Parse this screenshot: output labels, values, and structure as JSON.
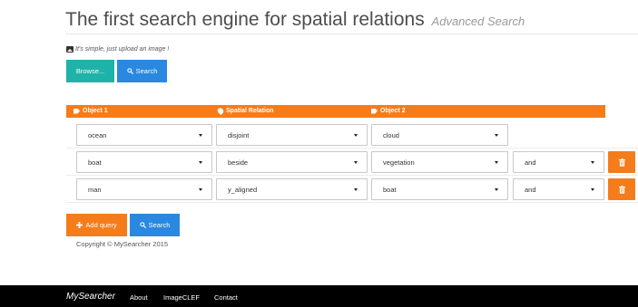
{
  "header": {
    "title": "The first search engine for spatial relations",
    "subtitle": "Advanced Search"
  },
  "upload": {
    "hint": "It's simple, just upload an image !",
    "browse_label": "Browse...",
    "search_label": "Search"
  },
  "table": {
    "columns": [
      "Object 1",
      "Spatial Relation",
      "Object 2"
    ],
    "rows": [
      {
        "object1": "ocean",
        "relation": "disjoint",
        "object2": "cloud",
        "connector": ""
      },
      {
        "object1": "boat",
        "relation": "beside",
        "object2": "vegetation",
        "connector": "and"
      },
      {
        "object1": "man",
        "relation": "y_aligned",
        "object2": "boat",
        "connector": "and"
      }
    ]
  },
  "actions": {
    "add_query_label": "Add query",
    "search_label": "Search"
  },
  "copyright": "Copyright © MySearcher 2015",
  "footer": {
    "brand": "MySearcher",
    "links": [
      "About",
      "ImageCLEF",
      "Contact"
    ]
  },
  "colors": {
    "accent_orange": "#f57c1b",
    "button_teal": "#1eb3a8",
    "button_blue": "#2a88e0",
    "footer_bg": "#000000"
  },
  "icons": {
    "hint": "image-icon",
    "search": "search-icon",
    "object": "tag-icon",
    "relation": "map-marker-icon",
    "add": "plus-icon",
    "delete": "trash-icon",
    "dropdown": "caret-down-icon"
  }
}
